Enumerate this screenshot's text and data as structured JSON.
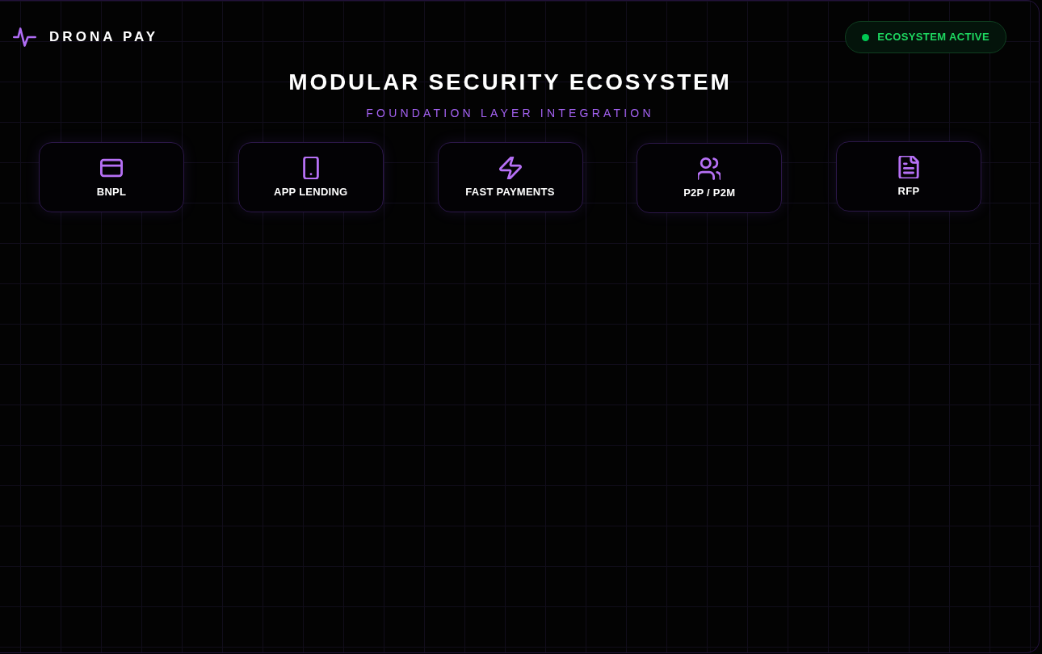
{
  "brand": {
    "name": "DRONA PAY"
  },
  "status_badge": {
    "label": "ECOSYSTEM ACTIVE",
    "active": true
  },
  "title": "MODULAR SECURITY ECOSYSTEM",
  "subtitle": "FOUNDATION LAYER INTEGRATION",
  "modules": [
    {
      "label": "BNPL"
    },
    {
      "label": "APP LENDING"
    },
    {
      "label": "FAST PAYMENTS"
    },
    {
      "label": "P2P / P2M"
    },
    {
      "label": "RFP"
    }
  ]
}
